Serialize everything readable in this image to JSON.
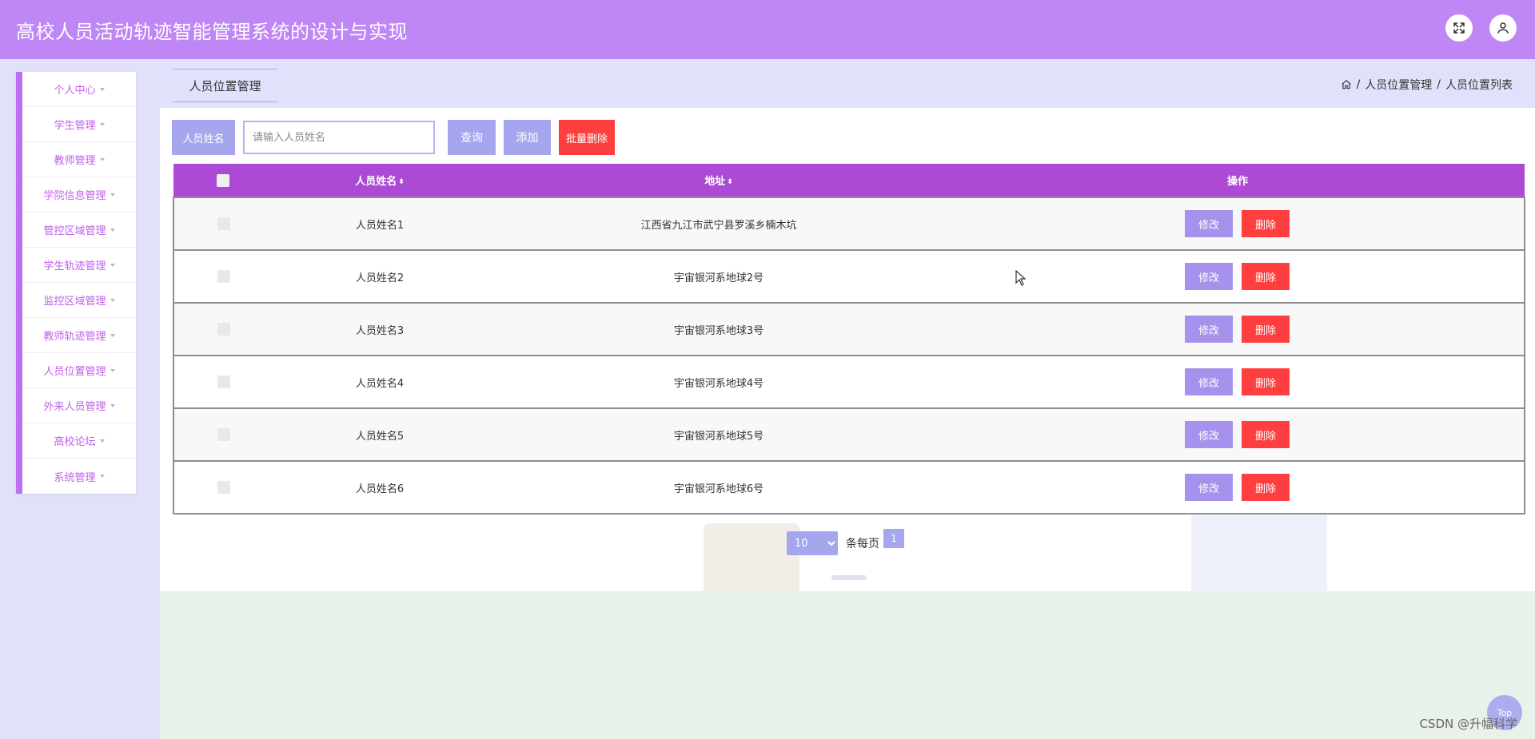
{
  "header": {
    "title": "高校人员活动轨迹智能管理系统的设计与实现",
    "fullscreen_icon": "expand-icon",
    "user_icon": "user-icon"
  },
  "sidebar": {
    "items": [
      {
        "label": "个人中心"
      },
      {
        "label": "学生管理"
      },
      {
        "label": "教师管理"
      },
      {
        "label": "学院信息管理"
      },
      {
        "label": "管控区域管理"
      },
      {
        "label": "学生轨迹管理"
      },
      {
        "label": "监控区域管理"
      },
      {
        "label": "教师轨迹管理"
      },
      {
        "label": "人员位置管理"
      },
      {
        "label": "外来人员管理"
      },
      {
        "label": "高校论坛"
      },
      {
        "label": "系统管理"
      }
    ]
  },
  "page": {
    "tab": "人员位置管理",
    "breadcrumb": [
      "人员位置管理",
      "人员位置列表"
    ],
    "breadcrumb_sep": "/"
  },
  "search": {
    "label": "人员姓名",
    "placeholder": "请输入人员姓名",
    "value": "",
    "query_button": "查询",
    "add_button": "添加",
    "batch_delete_button": "批量删除"
  },
  "table": {
    "columns": {
      "name": "人员姓名",
      "address": "地址",
      "actions": "操作"
    },
    "sort_glyph": "⬍",
    "rows": [
      {
        "name": "人员姓名1",
        "address": "江西省九江市武宁县罗溪乡楠木坑"
      },
      {
        "name": "人员姓名2",
        "address": "宇宙银河系地球2号"
      },
      {
        "name": "人员姓名3",
        "address": "宇宙银河系地球3号"
      },
      {
        "name": "人员姓名4",
        "address": "宇宙银河系地球4号"
      },
      {
        "name": "人员姓名5",
        "address": "宇宙银河系地球5号"
      },
      {
        "name": "人员姓名6",
        "address": "宇宙银河系地球6号"
      }
    ],
    "edit_label": "修改",
    "delete_label": "删除"
  },
  "pagination": {
    "page_size": "10",
    "per_page_label": "条每页",
    "current_page": "1"
  },
  "floating": {
    "top_label": "Top"
  },
  "watermark": "CSDN @升幅科学",
  "colors": {
    "header": "#bf86f5",
    "table_header": "#ad4ad5",
    "primary_button": "#a6a6ef",
    "danger_button": "#ff3f3f",
    "sidebar_text": "#c05fe8"
  }
}
